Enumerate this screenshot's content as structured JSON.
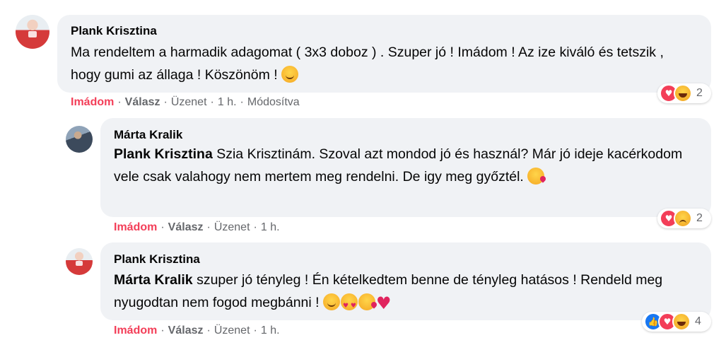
{
  "comments": [
    {
      "author": "Plank Krisztina",
      "text": "Ma rendeltem a harmadik adagomat ( 3x3 doboz ) . Szuper jó ! Imádom ! Az ize kiváló és tetszik , hogy gumi az állaga ! Köszönöm !",
      "trailing_emoji": [
        "smiling-face"
      ],
      "actions": {
        "reaction": "Imádom",
        "reply": "Válasz",
        "message": "Üzenet",
        "time": "1 h.",
        "edited": "Módosítva"
      },
      "reactions": {
        "icons": [
          "love",
          "haha"
        ],
        "count": "2"
      }
    },
    {
      "author": "Márta Kralik",
      "mention": "Plank Krisztina",
      "text": "Szia Krisztinám. Szoval azt mondod jó és használ? Már jó ideje kacérkodom vele csak valahogy nem mertem meg rendelni. De igy meg győztél.",
      "trailing_emoji": [
        "face-blowing-kiss"
      ],
      "actions": {
        "reaction": "Imádom",
        "reply": "Válasz",
        "message": "Üzenet",
        "time": "1 h."
      },
      "reactions": {
        "icons": [
          "love",
          "sad"
        ],
        "count": "2"
      }
    },
    {
      "author": "Plank Krisztina",
      "mention": "Márta Kralik",
      "text": "szuper jó tényleg ! Én kételkedtem benne de tényleg hatásos ! Rendeld meg nyugodtan nem fogod megbánni !",
      "trailing_emoji": [
        "smiling-face",
        "heart-eyes",
        "face-blowing-kiss",
        "red-heart"
      ],
      "actions": {
        "reaction": "Imádom",
        "reply": "Válasz",
        "message": "Üzenet",
        "time": "1 h."
      },
      "reactions": {
        "icons": [
          "like",
          "love",
          "haha"
        ],
        "count": "4"
      }
    }
  ],
  "colors": {
    "bubble": "#f0f2f5",
    "love_text": "#f33e58",
    "meta_text": "#65676b",
    "like_blue": "#1877f2"
  }
}
